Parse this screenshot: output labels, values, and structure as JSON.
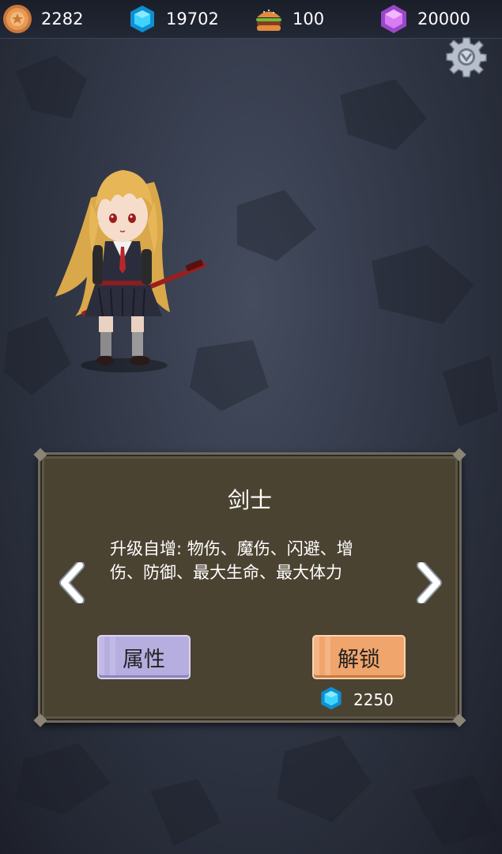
{
  "resources": {
    "coin": {
      "icon": "coin-icon",
      "value": "2282"
    },
    "gem": {
      "icon": "blue-gem-icon",
      "value": "19702"
    },
    "food": {
      "icon": "burger-icon",
      "value": "100"
    },
    "crystal": {
      "icon": "purple-crystal-icon",
      "value": "20000"
    }
  },
  "settings": {
    "icon": "gear-icon"
  },
  "character": {
    "icon": "swordswoman-character"
  },
  "panel": {
    "title": "剑士",
    "description_line1": "升级自增: 物伤、魔伤、闪避、增",
    "description_line2": "伤、防御、最大生命、最大体力",
    "prev_icon": "chevron-left-icon",
    "next_icon": "chevron-right-icon",
    "attributes_label": "属性",
    "unlock_label": "解锁",
    "unlock_cost": "2250",
    "unlock_cost_icon": "blue-gem-icon"
  },
  "colors": {
    "panel_bg": "#4b4331",
    "attributes_button": "#b7aee0",
    "unlock_button": "#f0a56c",
    "gem": "#1fb8ec",
    "crystal": "#c77ce8"
  }
}
